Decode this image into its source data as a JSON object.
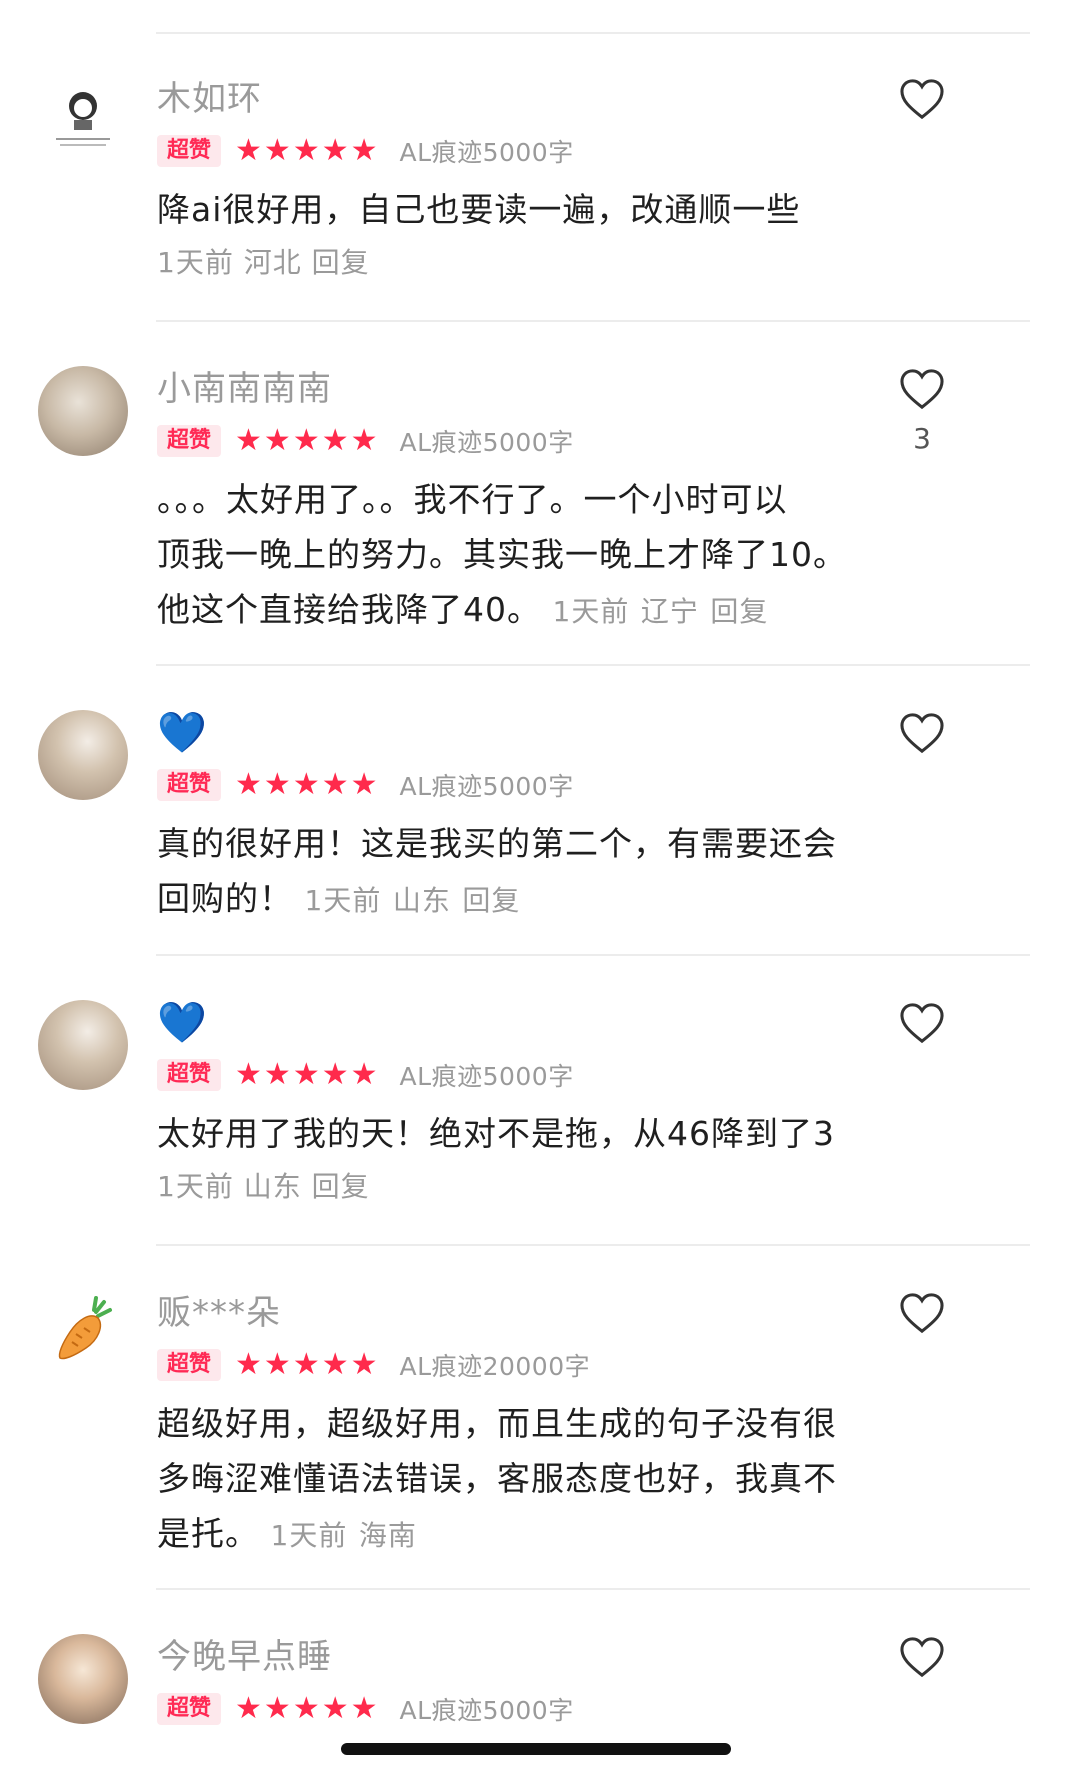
{
  "reviews": [
    {
      "username": "木如环",
      "badge": "超赞",
      "stars": 5,
      "spec": "AL痕迹5000字",
      "text": "降ai很好用，自己也要读一遍，改通顺一些",
      "time": "1天前",
      "region": "河北",
      "reply": "回复",
      "likes": ""
    },
    {
      "username": "小南南南南",
      "badge": "超赞",
      "stars": 5,
      "spec": "AL痕迹5000字",
      "text_lines": [
        "。。。太好用了。。我不行了。一个小时可以",
        "顶我一晚上的努力。其实我一晚上才降了10。",
        "他这个直接给我降了40。"
      ],
      "time": "1天前",
      "region": "辽宁",
      "reply": "回复",
      "likes": "3"
    },
    {
      "username": "💙",
      "badge": "超赞",
      "stars": 5,
      "spec": "AL痕迹5000字",
      "text_lines": [
        "真的很好用！这是我买的第二个，有需要还会",
        "回购的！"
      ],
      "time": "1天前",
      "region": "山东",
      "reply": "回复",
      "likes": ""
    },
    {
      "username": "💙",
      "badge": "超赞",
      "stars": 5,
      "spec": "AL痕迹5000字",
      "text": "太好用了我的天！绝对不是拖，从46降到了3",
      "time": "1天前",
      "region": "山东",
      "reply": "回复",
      "likes": ""
    },
    {
      "username": "贩***朵",
      "badge": "超赞",
      "stars": 5,
      "spec": "AL痕迹20000字",
      "text_lines": [
        "超级好用，超级好用，而且生成的句子没有很",
        "多晦涩难懂语法错误，客服态度也好，我真不",
        "是托。"
      ],
      "time": "1天前",
      "region": "海南",
      "reply": "",
      "likes": ""
    },
    {
      "username": "今晚早点睡",
      "badge": "超赞",
      "stars": 5,
      "spec": "AL痕迹5000字",
      "likes": ""
    }
  ],
  "icons": {
    "like": "heart-outline-icon",
    "star": "star-icon",
    "avatar_carrot": "carrot-icon"
  },
  "colors": {
    "accent_red": "#ff2a4c",
    "badge_bg": "#fde8ec",
    "muted_text": "#9a9a9a",
    "blue_heart": "#1e88ff"
  }
}
